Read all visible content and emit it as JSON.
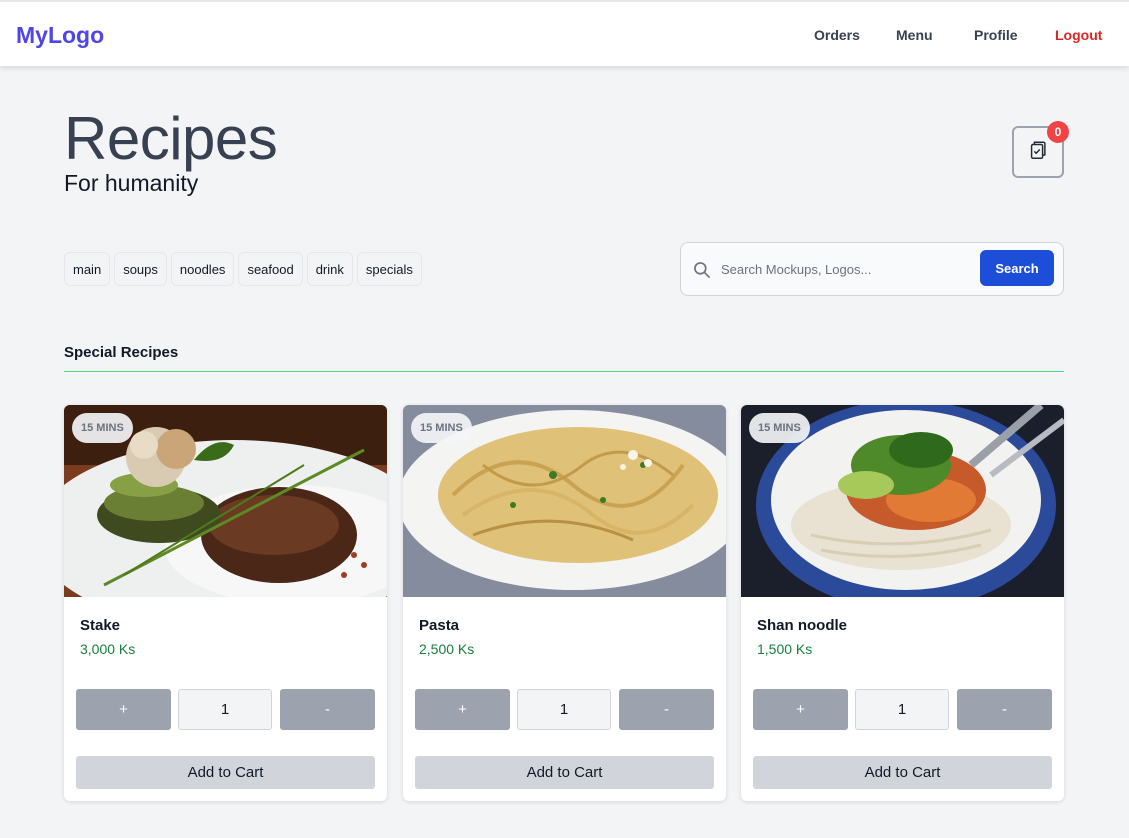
{
  "nav": {
    "logo": "MyLogo",
    "links": [
      "Orders",
      "Menu",
      "Profile",
      "Logout"
    ]
  },
  "header": {
    "title": "Recipes",
    "subtitle": "For humanity",
    "cart_icon": "clipboard-check-icon",
    "cart_count": "0"
  },
  "categories": [
    "main",
    "soups",
    "noodles",
    "seafood",
    "drink",
    "specials"
  ],
  "search": {
    "placeholder": "Search Mockups, Logos...",
    "value": "",
    "button_label": "Search",
    "icon": "search-icon"
  },
  "section": {
    "title": "Special Recipes"
  },
  "cards": [
    {
      "time": "15 MINS",
      "name": "Stake",
      "price": "3,000 Ks",
      "plus": "+",
      "qty": "1",
      "minus": "-",
      "add_label": "Add to Cart",
      "image": "steak-photo"
    },
    {
      "time": "15 MINS",
      "name": "Pasta",
      "price": "2,500 Ks",
      "plus": "+",
      "qty": "1",
      "minus": "-",
      "add_label": "Add to Cart",
      "image": "pasta-photo"
    },
    {
      "time": "15 MINS",
      "name": "Shan noodle",
      "price": "1,500 Ks",
      "plus": "+",
      "qty": "1",
      "minus": "-",
      "add_label": "Add to Cart",
      "image": "shan-noodle-photo"
    }
  ],
  "colors": {
    "brand": "#4f46e5",
    "logout": "#dc2626",
    "search_button": "#1d4ed8",
    "badge": "#ef4444",
    "price": "#15803d",
    "divider": "#4ade80"
  }
}
